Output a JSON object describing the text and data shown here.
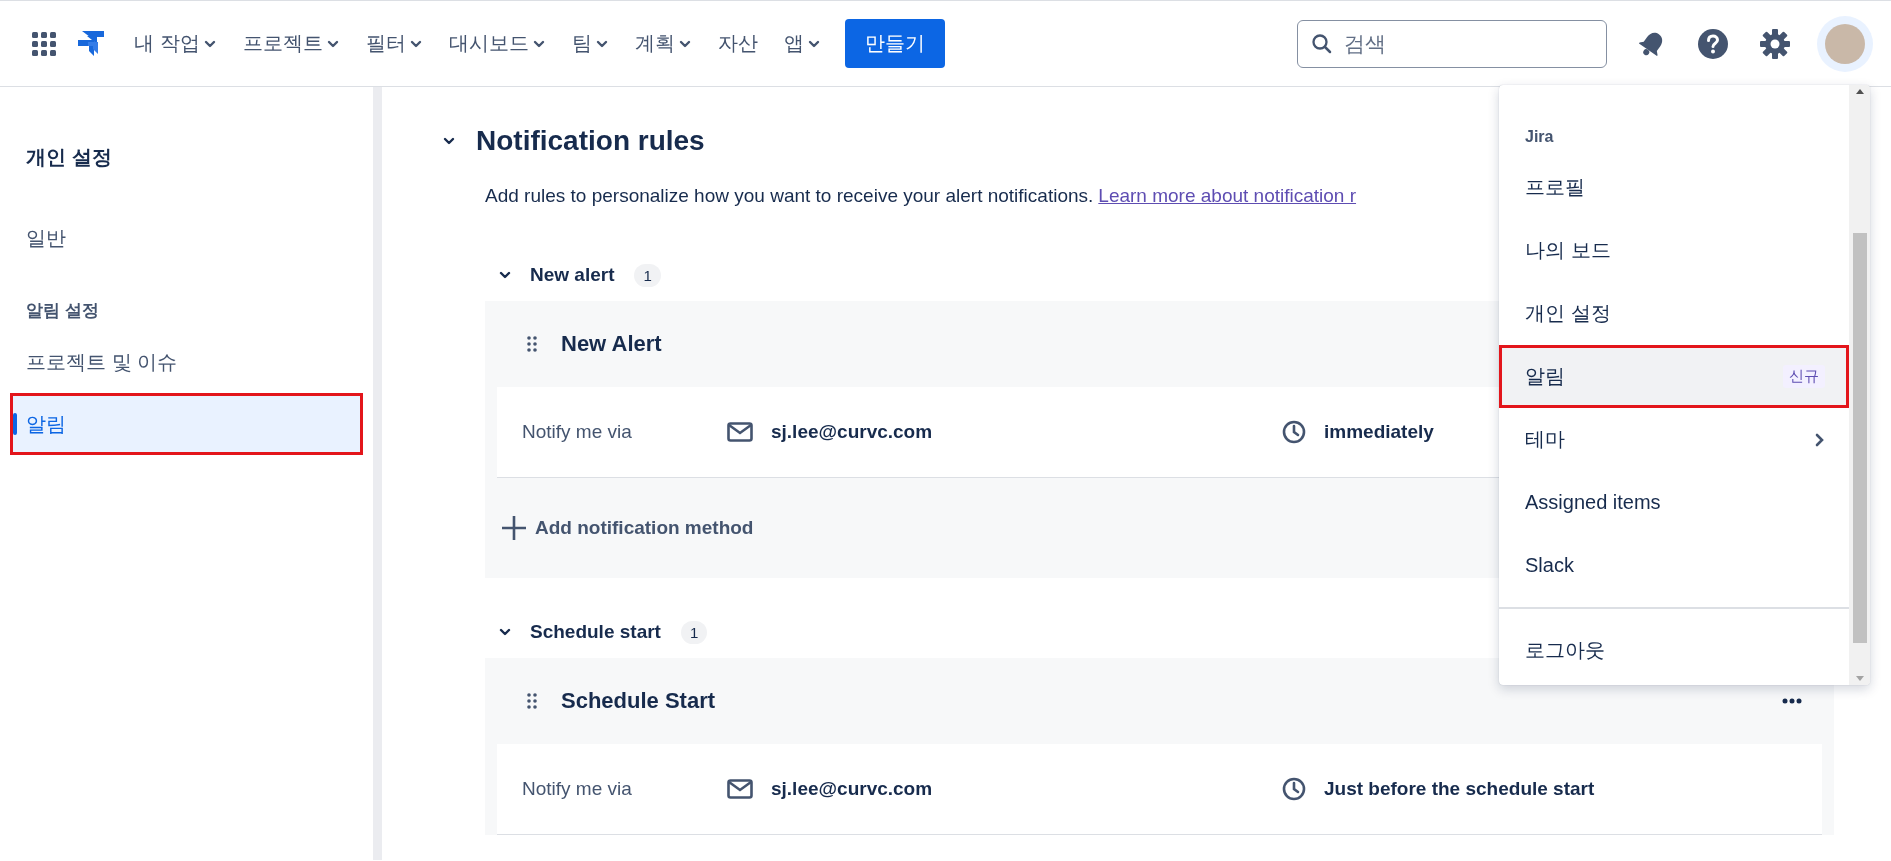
{
  "top_nav": {
    "items": [
      {
        "label": "내 작업",
        "has_menu": true
      },
      {
        "label": "프로젝트",
        "has_menu": true
      },
      {
        "label": "필터",
        "has_menu": true
      },
      {
        "label": "대시보드",
        "has_menu": true
      },
      {
        "label": "팀",
        "has_menu": true
      },
      {
        "label": "계획",
        "has_menu": true
      },
      {
        "label": "자산",
        "has_menu": false
      },
      {
        "label": "앱",
        "has_menu": true
      }
    ],
    "create_button": "만들기",
    "search": {
      "placeholder": "검색"
    }
  },
  "sidebar": {
    "title": "개인 설정",
    "items": [
      {
        "kind": "link",
        "label": "일반",
        "selected": false,
        "highlighted": false
      },
      {
        "kind": "heading",
        "label": "알림 설정"
      },
      {
        "kind": "link",
        "label": "프로젝트 및 이슈",
        "selected": false,
        "highlighted": false
      },
      {
        "kind": "link",
        "label": "알림",
        "selected": true,
        "highlighted": true
      }
    ]
  },
  "main": {
    "title": "Notification rules",
    "expanded": true,
    "description": "Add rules to personalize how you want to receive your alert notifications.",
    "link": "Learn more about notification r",
    "groups": [
      {
        "name": "New alert",
        "count": "1",
        "expanded": true,
        "rules": [
          {
            "title": "New Alert",
            "methods": [
              {
                "label": "Notify me via",
                "address": "sj.lee@curvc.com",
                "timing": "immediately"
              }
            ],
            "add_method": "Add notification method"
          }
        ]
      },
      {
        "name": "Schedule start",
        "count": "1",
        "expanded": true,
        "rules": [
          {
            "title": "Schedule Start",
            "menu_button": true,
            "methods": [
              {
                "label": "Notify me via",
                "address": "sj.lee@curvc.com",
                "timing": "Just before the schedule start"
              }
            ]
          }
        ]
      }
    ]
  },
  "profile_menu": {
    "section": "Jira",
    "items": [
      {
        "kind": "item",
        "label": "프로필",
        "selected": false,
        "highlighted": false
      },
      {
        "kind": "item",
        "label": "나의 보드",
        "selected": false,
        "highlighted": false
      },
      {
        "kind": "item",
        "label": "개인 설정",
        "selected": false,
        "highlighted": false
      },
      {
        "kind": "item",
        "label": "알림",
        "badge": "신규",
        "selected": true,
        "highlighted": true
      },
      {
        "kind": "submenu",
        "label": "테마",
        "selected": false,
        "highlighted": false
      },
      {
        "kind": "item",
        "label": "Assigned items",
        "selected": false,
        "highlighted": false
      },
      {
        "kind": "item",
        "label": "Slack",
        "selected": false,
        "highlighted": false
      },
      {
        "kind": "divider"
      },
      {
        "kind": "item",
        "label": "로그아웃",
        "selected": false,
        "highlighted": false
      }
    ]
  }
}
